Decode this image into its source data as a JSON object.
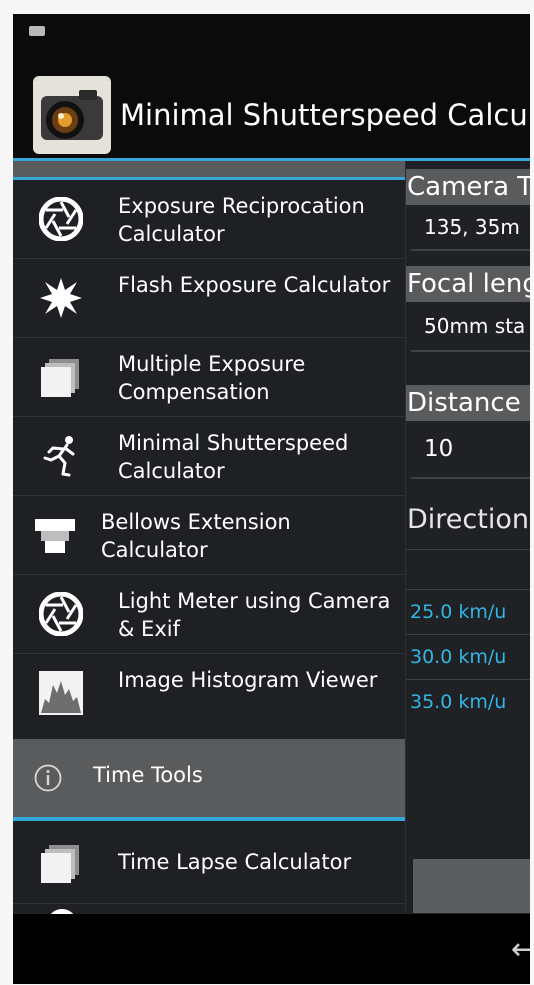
{
  "app": {
    "title": "Minimal Shutterspeed Calculator"
  },
  "drawer": {
    "items": [
      {
        "label": "Exposure Reciprocation Calculator",
        "icon": "aperture-icon"
      },
      {
        "label": "Flash Exposure Calculator",
        "icon": "flash-burst-icon"
      },
      {
        "label": "Multiple Exposure Compensation",
        "icon": "stacked-frames-icon"
      },
      {
        "label": "Minimal Shutterspeed Calculator",
        "icon": "running-person-icon"
      },
      {
        "label": "Bellows Extension Calculator",
        "icon": "bellows-icon"
      },
      {
        "label": "Light Meter using Camera & Exif",
        "icon": "aperture-icon"
      },
      {
        "label": "Image Histogram Viewer",
        "icon": "histogram-icon"
      }
    ],
    "section": {
      "label": "Time Tools",
      "icon": "info-icon"
    },
    "after_items": [
      {
        "label": "Time Lapse Calculator",
        "icon": "stacked-frames-icon"
      }
    ]
  },
  "panel": {
    "camera_type_header": "Camera T",
    "camera_type_value": "135, 35m",
    "focal_length_header": "Focal leng",
    "focal_length_value": "50mm sta",
    "distance_header": "Distance",
    "distance_value": "10",
    "direction_label": "Direction",
    "speeds": [
      "25.0 km/u",
      "30.0 km/u",
      "35.0 km/u"
    ]
  },
  "navbar": {
    "back_icon": "back-arrow-icon"
  },
  "colors": {
    "accent": "#35a6d8",
    "speed_text": "#33b5e5",
    "drawer_bg": "#1e2023",
    "section_bg": "#5a5b5d"
  }
}
